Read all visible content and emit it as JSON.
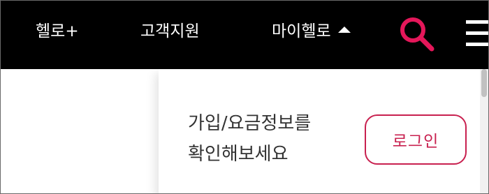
{
  "header": {
    "nav": [
      {
        "label": "헬로+"
      },
      {
        "label": "고객지원"
      },
      {
        "label": "마이헬로"
      }
    ],
    "search_icon": "search-icon",
    "menu_icon": "hamburger-menu-icon",
    "accent_color": "#e5175a"
  },
  "dropdown": {
    "message_line1": "가입/요금정보를",
    "message_line2": "확인해보세요",
    "login_label": "로그인",
    "login_color": "#c8204f"
  }
}
